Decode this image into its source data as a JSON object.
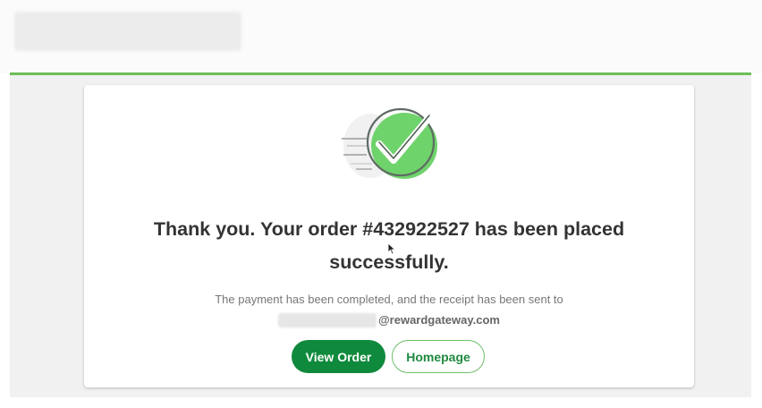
{
  "confirmation": {
    "title": "Thank you. Your order #432922527 has been placed successfully.",
    "message": "The payment has been completed, and the receipt has been sent to",
    "email_domain": "@rewardgateway.com"
  },
  "actions": {
    "view_order_label": "View Order",
    "homepage_label": "Homepage"
  },
  "icons": {
    "success": "check-circle-icon",
    "cursor": "mouse-pointer-icon"
  },
  "colors": {
    "accent_green": "#6bbf57",
    "button_green": "#0f8a3c",
    "check_green": "#6fd36b",
    "title_text": "#333333"
  }
}
